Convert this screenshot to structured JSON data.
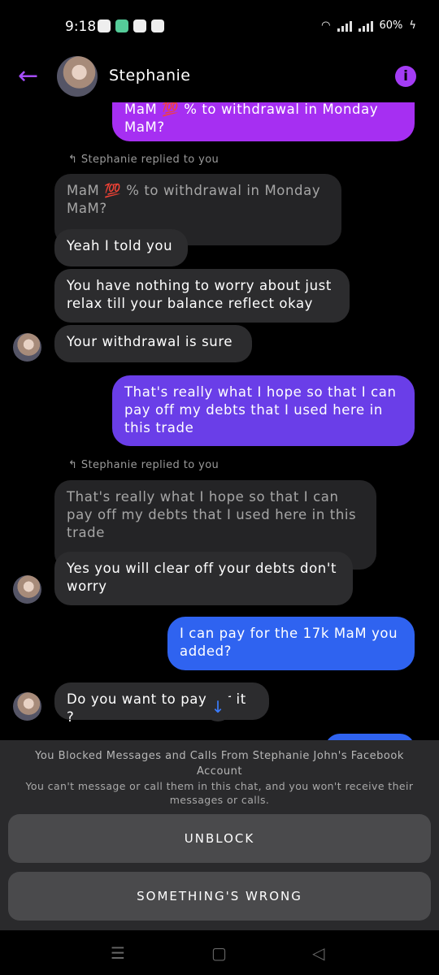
{
  "status_bar": {
    "time": "9:18",
    "battery": "60%"
  },
  "header": {
    "contact_name": "Stephanie",
    "back_icon": "arrow-left-icon",
    "info_icon": "info-icon",
    "accent": "#a43cf5"
  },
  "messages": [
    {
      "id": "m0",
      "dir": "out",
      "text": "MaM 💯 % to withdrawal in Monday MaM?",
      "color": "#a62ff2"
    },
    {
      "id": "r1",
      "dir": "reply-label",
      "text": "Stephanie replied to you"
    },
    {
      "id": "m1q",
      "dir": "in-quoted",
      "text": "MaM 💯 % to withdrawal in Monday MaM?"
    },
    {
      "id": "m2",
      "dir": "in",
      "text": "Yeah I told you"
    },
    {
      "id": "m3",
      "dir": "in",
      "text": "You have nothing to worry about just relax till your balance reflect okay"
    },
    {
      "id": "m4",
      "dir": "in",
      "text": "Your withdrawal is sure"
    },
    {
      "id": "m5",
      "dir": "out",
      "text": "That's really what I hope so that I can pay off my debts that I used here in this trade",
      "color": "#6a3ee8"
    },
    {
      "id": "r2",
      "dir": "reply-label",
      "text": "Stephanie replied to you"
    },
    {
      "id": "m6q",
      "dir": "in-quoted",
      "text": "That's really what I hope so that I can pay off my debts that I used here in this trade"
    },
    {
      "id": "m7",
      "dir": "in",
      "text": "Yes you will clear off your debts don't worry"
    },
    {
      "id": "m8",
      "dir": "out",
      "text": "I can pay for the 17k MaM you added?",
      "color": "#2f63f0"
    },
    {
      "id": "m9",
      "dir": "in",
      "text": "Do you want to pay for it ?"
    }
  ],
  "blocked_notice": {
    "title": "You Blocked Messages and Calls From Stephanie John's Facebook Account",
    "subtitle": "You can't message or call them in this chat, and you won't receive their messages or calls.",
    "unblock_label": "UNBLOCK",
    "wrong_label": "SOMETHING'S WRONG"
  }
}
